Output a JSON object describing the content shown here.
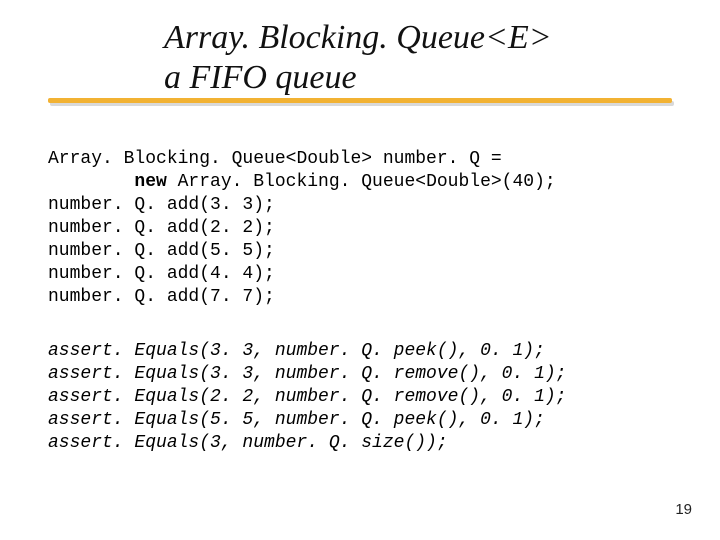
{
  "title": {
    "line1": "Array. Blocking. Queue<E>",
    "line2": "a  FIFO queue"
  },
  "code": {
    "decl1": "Array. Blocking. Queue<Double> number. Q =",
    "decl2_pre": "        ",
    "decl2_kw": "new",
    "decl2_post": " Array. Blocking. Queue<Double>(40);",
    "l3": "number. Q. add(3. 3);",
    "l4": "number. Q. add(2. 2);",
    "l5": "number. Q. add(5. 5);",
    "l6": "number. Q. add(4. 4);",
    "l7": "number. Q. add(7. 7);"
  },
  "asserts": {
    "a1": "assert. Equals(3. 3, number. Q. peek(), 0. 1);",
    "a2": "assert. Equals(3. 3, number. Q. remove(), 0. 1);",
    "a3": "assert. Equals(2. 2, number. Q. remove(), 0. 1);",
    "a4": "assert. Equals(5. 5, number. Q. peek(), 0. 1);",
    "a5": "assert. Equals(3, number. Q. size());"
  },
  "page_number": "19"
}
